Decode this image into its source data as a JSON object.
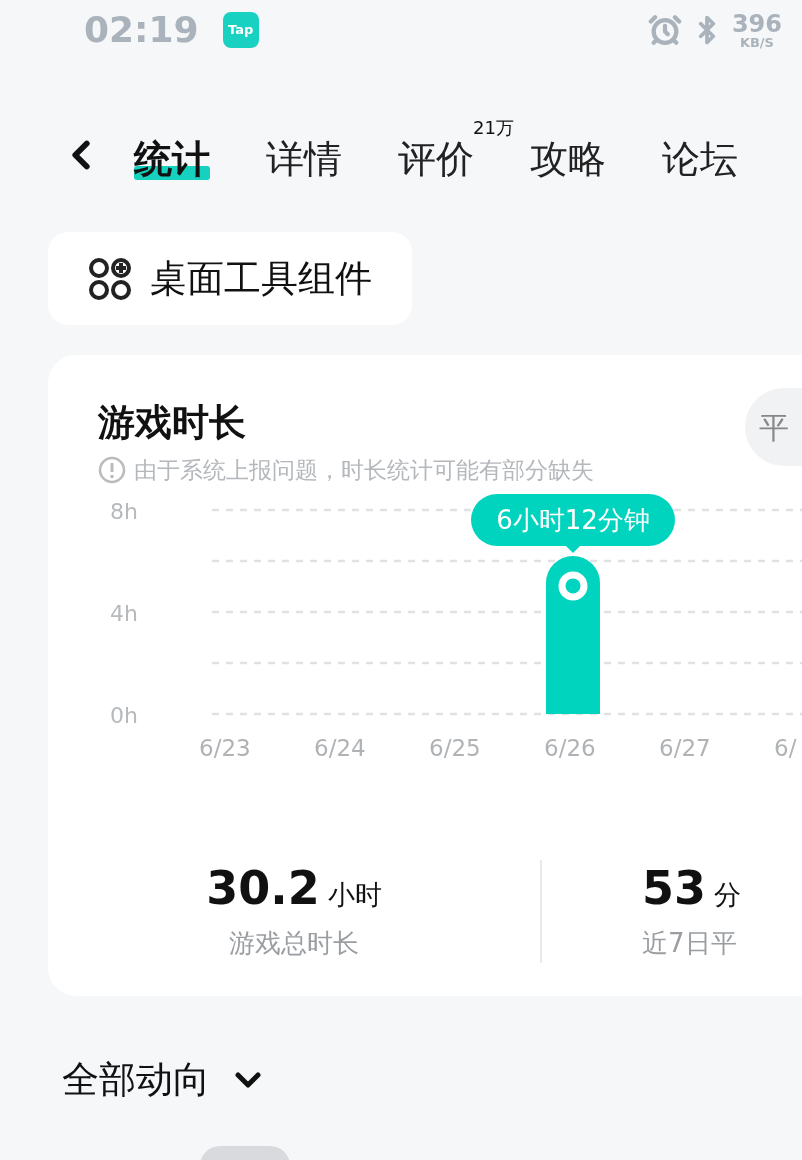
{
  "status_bar": {
    "time": "02:19",
    "app_badge": "Tap",
    "speed": "396",
    "speed_unit": "KB/S"
  },
  "tabs": [
    {
      "label": "统计",
      "selected": true
    },
    {
      "label": "详情",
      "selected": false
    },
    {
      "label": "评价",
      "selected": false,
      "badge": "21万"
    },
    {
      "label": "攻略",
      "selected": false
    },
    {
      "label": "论坛",
      "selected": false
    }
  ],
  "widget_button": {
    "label": "桌面工具组件"
  },
  "playtime_card": {
    "title": "游戏时长",
    "notice": "由于系统上报问题，时长统计可能有部分缺失",
    "toggle_label": "平",
    "chart_data": {
      "type": "bar",
      "categories": [
        "6/23",
        "6/24",
        "6/25",
        "6/26",
        "6/27",
        "6/"
      ],
      "series": [
        {
          "color": "#00d4bf",
          "values": [
            0,
            0,
            0,
            6.2,
            0,
            null
          ]
        }
      ],
      "ylim": [
        0,
        8
      ],
      "yticks": [
        {
          "value": 0,
          "label": "0h"
        },
        {
          "value": 4,
          "label": "4h"
        },
        {
          "value": 8,
          "label": "8h"
        }
      ],
      "annotations": [
        "6小时12分钟"
      ]
    },
    "stats": [
      {
        "value": "30.2",
        "unit": "小时",
        "label": "游戏总时长"
      },
      {
        "value": "53",
        "unit": "分",
        "label": "近7日平"
      }
    ]
  },
  "activity": {
    "title": "全部动向"
  }
}
